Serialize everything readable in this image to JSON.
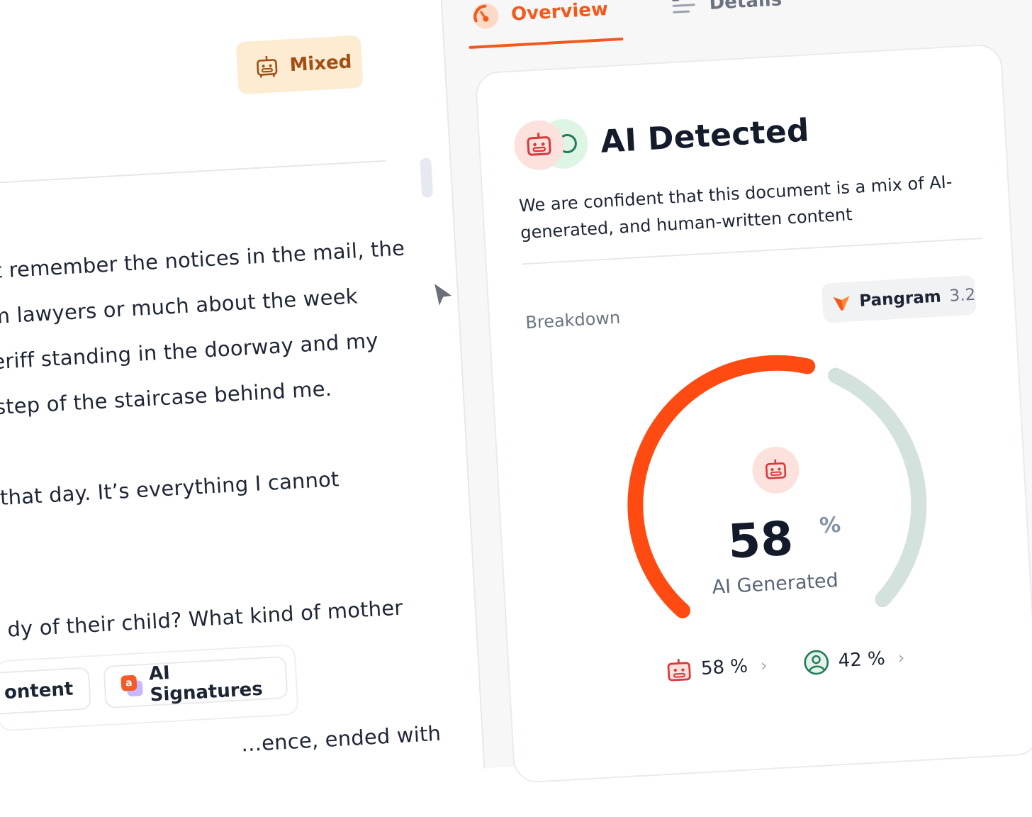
{
  "document": {
    "badge_label": "Mixed",
    "lines": [
      "’t remember the notices in the mail, the",
      "m lawyers or much about the week",
      "eriff standing in the doorway and my",
      "step of the staircase behind me.",
      "that day. It’s everything I cannot",
      "dy of their child? What kind of mother",
      "…ence, ended with"
    ]
  },
  "chips": {
    "content_label": "ontent",
    "signatures_label": "AI Signatures",
    "signatures_icon_letter": "a"
  },
  "tabs": {
    "overview": "Overview",
    "details": "Details"
  },
  "result": {
    "title": "AI Detected",
    "description": "We are confident that this document is a mix of AI-generated, and human-written content",
    "breakdown_label": "Breakdown",
    "model_name": "Pangram",
    "model_version": "3.2",
    "percent_value": "58",
    "percent_sign": "%",
    "gauge_label": "AI Generated",
    "ai_stat": "58 %",
    "human_stat": "42 %"
  },
  "gauge_data": {
    "ai_percent": 58,
    "human_percent": 42
  },
  "colors": {
    "accent": "#f2591d",
    "gauge_ai": "#ff4b12",
    "gauge_human": "#d3e2dc",
    "robot_red": "#d8393c",
    "human_green": "#1f7a55"
  },
  "icons": {
    "badge": "robot-icon",
    "overview_tab": "gauge-icon",
    "details_tab": "list-icon",
    "title_primary": "robot-icon",
    "title_secondary": "human-icon",
    "model": "pangram-logo-icon",
    "ai_stat": "robot-icon",
    "human_stat": "user-circle-icon"
  }
}
